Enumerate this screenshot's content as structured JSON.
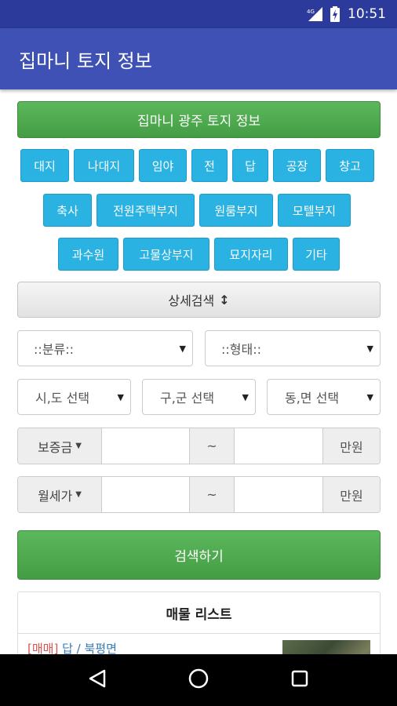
{
  "status_bar": {
    "time": "10:51"
  },
  "app_bar": {
    "title": "집마니 토지 정보"
  },
  "banner": {
    "label": "집마니 광주 토지 정보"
  },
  "categories": [
    "대지",
    "나대지",
    "임야",
    "전",
    "답",
    "공장",
    "창고",
    "축사",
    "전원주택부지",
    "원룸부지",
    "모텔부지",
    "과수원",
    "고물상부지",
    "묘지자리",
    "기타"
  ],
  "detail_search": {
    "label": "상세검색",
    "arrow": "↕"
  },
  "filters": {
    "classification": "::분류::",
    "type": "::형태::",
    "sido": "시,도 선택",
    "gugun": "구,군 선택",
    "dong": "동,면 선택"
  },
  "deposit": {
    "label": "보증금",
    "min": "",
    "tilde": "~",
    "max": "",
    "unit": "만원"
  },
  "monthly": {
    "label": "월세가",
    "min": "",
    "tilde": "~",
    "max": "",
    "unit": "만원"
  },
  "search_button": {
    "label": "검색하기"
  },
  "listing": {
    "title": "매물 리스트",
    "items": [
      {
        "tag": "[매매]",
        "text": "답 / 북평면"
      }
    ]
  },
  "colors": {
    "primary": "#3f51b5",
    "status": "#2b3a9b",
    "chip": "#29b2e2",
    "green": "#5cb85c"
  }
}
